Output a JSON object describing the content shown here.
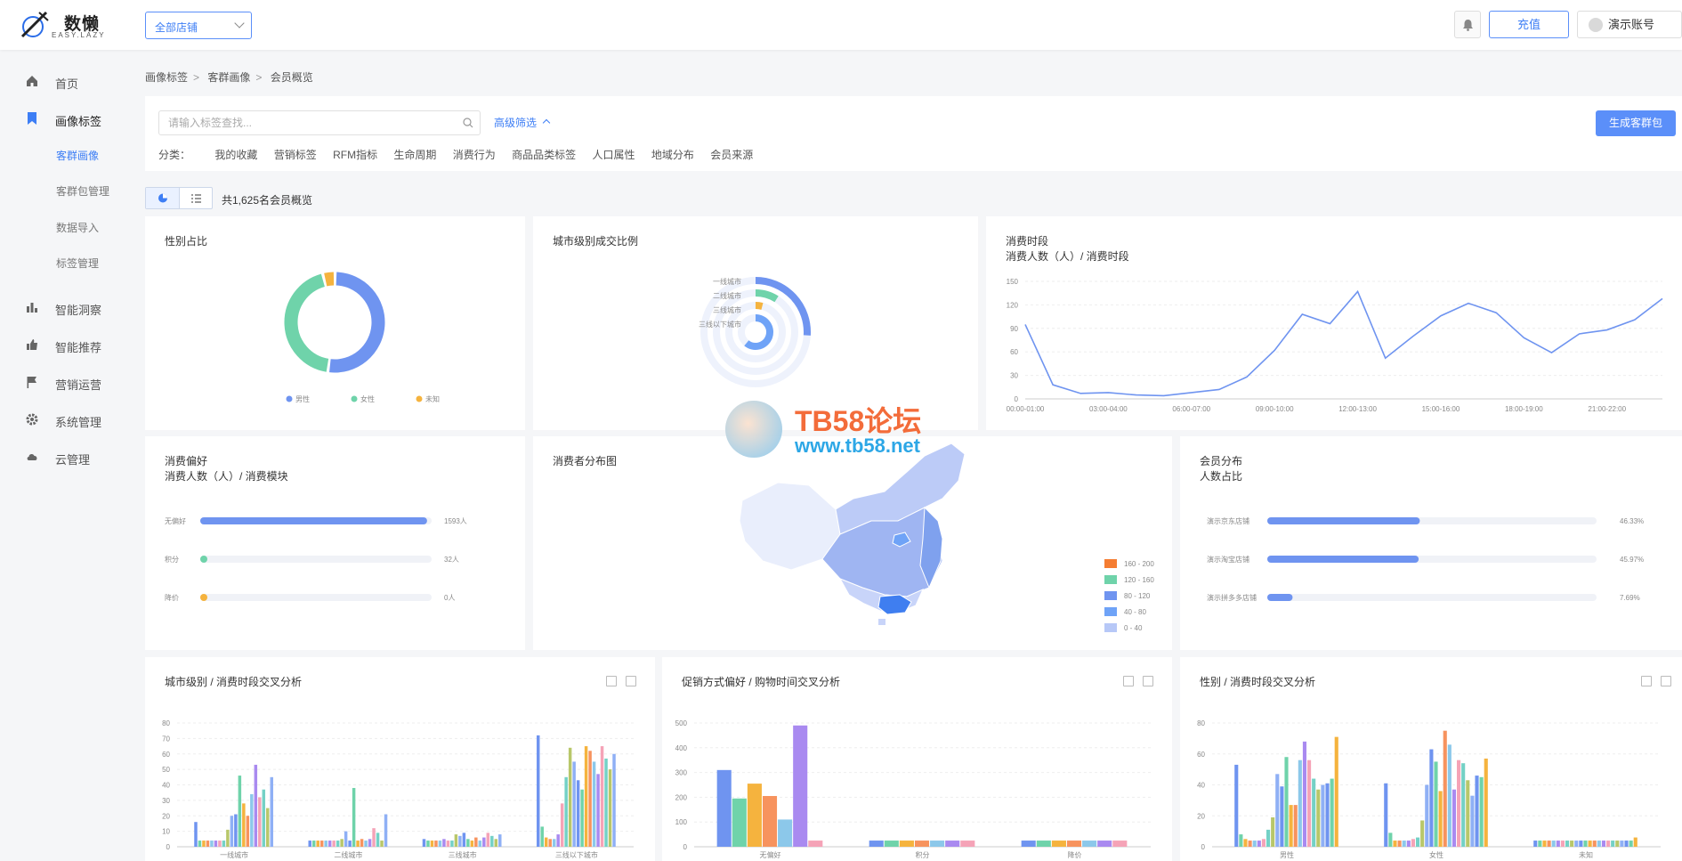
{
  "header": {
    "logo_name": "数懒",
    "logo_sub": "EASY.LAZY",
    "store_select": "全部店铺",
    "recharge": "充值",
    "account": "演示账号"
  },
  "sidebar": {
    "items": [
      {
        "label": "首页",
        "icon": "home-icon"
      },
      {
        "label": "画像标签",
        "icon": "bookmark-icon"
      },
      {
        "label": "智能洞察",
        "icon": "bar-chart-icon"
      },
      {
        "label": "智能推荐",
        "icon": "thumbs-up-icon"
      },
      {
        "label": "营销运营",
        "icon": "flag-icon"
      },
      {
        "label": "系统管理",
        "icon": "gear-icon"
      },
      {
        "label": "云管理",
        "icon": "cloud-icon"
      }
    ],
    "sub_items": [
      "客群画像",
      "客群包管理",
      "数据导入",
      "标签管理"
    ]
  },
  "breadcrumb": [
    "画像标签",
    "客群画像",
    "会员概览"
  ],
  "filter": {
    "search_placeholder": "请输入标签查找...",
    "advanced": "高级筛选",
    "generate": "生成客群包",
    "category_label": "分类：",
    "categories": [
      "我的收藏",
      "营销标签",
      "RFM指标",
      "生命周期",
      "消费行为",
      "商品品类标签",
      "人口属性",
      "地域分布",
      "会员来源"
    ]
  },
  "total_text": "共1,625名会员概览",
  "cards": {
    "gender": {
      "title": "性别占比"
    },
    "city_level": {
      "title": "城市级别成交比例"
    },
    "time_slot": {
      "title": "消费时段",
      "subtitle": "消费人数（人）/ 消费时段"
    },
    "preference": {
      "title": "消费偏好",
      "subtitle": "消费人数（人）/ 消费模块"
    },
    "map": {
      "title": "消费者分布图"
    },
    "member": {
      "title": "会员分布",
      "subtitle": "人数占比"
    },
    "cross1": {
      "title": "城市级别 / 消费时段交叉分析"
    },
    "cross2": {
      "title": "促销方式偏好 / 购物时间交叉分析"
    },
    "cross3": {
      "title": "性别 / 消费时段交叉分析"
    }
  },
  "watermark": {
    "t1": "TB58论坛",
    "t2": "www.tb58.net"
  },
  "colors": {
    "blue": "#6f94f0",
    "green": "#6fd3aa",
    "yellow": "#f5b33e",
    "orange": "#f7935e",
    "accent": "#3d7ef5"
  },
  "chart_data": [
    {
      "id": "gender",
      "type": "pie",
      "labels": [
        "男性",
        "女性",
        "未知"
      ],
      "values": [
        52,
        44,
        4
      ]
    },
    {
      "id": "city_level",
      "type": "pie",
      "labels": [
        "一线城市",
        "二线城市",
        "三线城市",
        "三线以下城市"
      ],
      "values": [
        26,
        9,
        4,
        61
      ]
    },
    {
      "id": "time_slot",
      "type": "line",
      "x": [
        "00:00-01:00",
        "01:00-02:00",
        "02:00-03:00",
        "03:00-04:00",
        "04:00-05:00",
        "05:00-06:00",
        "06:00-07:00",
        "07:00-08:00",
        "08:00-09:00",
        "09:00-10:00",
        "10:00-11:00",
        "11:00-12:00",
        "12:00-13:00",
        "13:00-14:00",
        "14:00-15:00",
        "15:00-16:00",
        "16:00-17:00",
        "17:00-18:00",
        "18:00-19:00",
        "19:00-20:00",
        "20:00-21:00",
        "21:00-22:00",
        "22:00-23:00",
        "23:00-24:00"
      ],
      "xticks": [
        "00:00-01:00",
        "03:00-04:00",
        "06:00-07:00",
        "09:00-10:00",
        "12:00-13:00",
        "15:00-16:00",
        "18:00-19:00",
        "21:00-22:00"
      ],
      "values": [
        95,
        18,
        7,
        8,
        5,
        4,
        8,
        12,
        28,
        62,
        108,
        96,
        137,
        52,
        80,
        106,
        122,
        110,
        78,
        59,
        83,
        88,
        101,
        128
      ],
      "ylim": [
        0,
        150
      ],
      "yticks": [
        0,
        30,
        60,
        90,
        120,
        150
      ]
    },
    {
      "id": "preference",
      "type": "bar",
      "categories": [
        "无偏好",
        "积分",
        "降价"
      ],
      "values": [
        1593,
        32,
        0
      ],
      "value_labels": [
        "1593人",
        "32人",
        "0人"
      ],
      "max": 1625
    },
    {
      "id": "map_legend",
      "type": "heatmap",
      "legend": [
        "160 - 200",
        "120 - 160",
        "80 - 120",
        "40 - 80",
        "0 - 40"
      ]
    },
    {
      "id": "member",
      "type": "bar",
      "categories": [
        "演示京东店铺",
        "演示淘宝店铺",
        "演示拼多多店铺"
      ],
      "values": [
        46.33,
        45.97,
        7.69
      ],
      "value_labels": [
        "46.33%",
        "45.97%",
        "7.69%"
      ]
    },
    {
      "id": "cross1",
      "type": "bar",
      "categories": [
        "一线城市",
        "二线城市",
        "三线城市",
        "三线以下城市"
      ],
      "ylim": [
        0,
        80
      ],
      "yticks": [
        0,
        10,
        20,
        30,
        40,
        50,
        60,
        70,
        80
      ],
      "groups": [
        [
          16,
          4,
          4,
          4,
          4,
          4,
          4,
          4,
          11,
          20,
          21,
          46,
          28,
          20,
          34,
          53,
          32,
          37,
          25,
          45
        ],
        [
          4,
          4,
          4,
          4,
          4,
          4,
          4,
          4,
          5,
          10,
          4,
          38,
          4,
          5,
          4,
          5,
          12,
          9,
          4,
          21
        ],
        [
          5,
          4,
          4,
          4,
          4,
          5,
          4,
          4,
          8,
          7,
          9,
          5,
          4,
          6,
          4,
          6,
          9,
          7,
          5,
          8
        ],
        [
          72,
          13,
          6,
          5,
          5,
          8,
          28,
          45,
          64,
          55,
          43,
          37,
          65,
          62,
          55,
          47,
          65,
          57,
          50,
          60
        ]
      ]
    },
    {
      "id": "cross2",
      "type": "bar",
      "categories": [
        "无偏好",
        "积分",
        "降价"
      ],
      "ylim": [
        0,
        500
      ],
      "yticks": [
        0,
        100,
        200,
        300,
        400,
        500
      ],
      "groups": [
        [
          310,
          195,
          255,
          205,
          110,
          490,
          25
        ],
        [
          25,
          25,
          25,
          25,
          25,
          25,
          25
        ],
        [
          25,
          25,
          25,
          25,
          25,
          25,
          25
        ]
      ]
    },
    {
      "id": "cross3",
      "type": "bar",
      "categories": [
        "男性",
        "女性",
        "未知"
      ],
      "ylim": [
        0,
        80
      ],
      "yticks": [
        0,
        20,
        40,
        60,
        80
      ],
      "groups": [
        [
          53,
          8,
          5,
          4,
          4,
          4,
          5,
          11,
          19,
          47,
          39,
          58,
          27,
          27,
          56,
          68,
          56,
          44,
          37,
          40,
          41,
          44,
          71
        ],
        [
          41,
          9,
          4,
          4,
          4,
          4,
          5,
          6,
          17,
          40,
          63,
          55,
          36,
          75,
          66,
          37,
          56,
          54,
          43,
          33,
          46,
          45,
          57
        ],
        [
          4,
          4,
          4,
          4,
          4,
          4,
          4,
          4,
          4,
          4,
          4,
          4,
          4,
          4,
          4,
          4,
          4,
          4,
          4,
          4,
          4,
          4,
          6
        ]
      ]
    }
  ]
}
